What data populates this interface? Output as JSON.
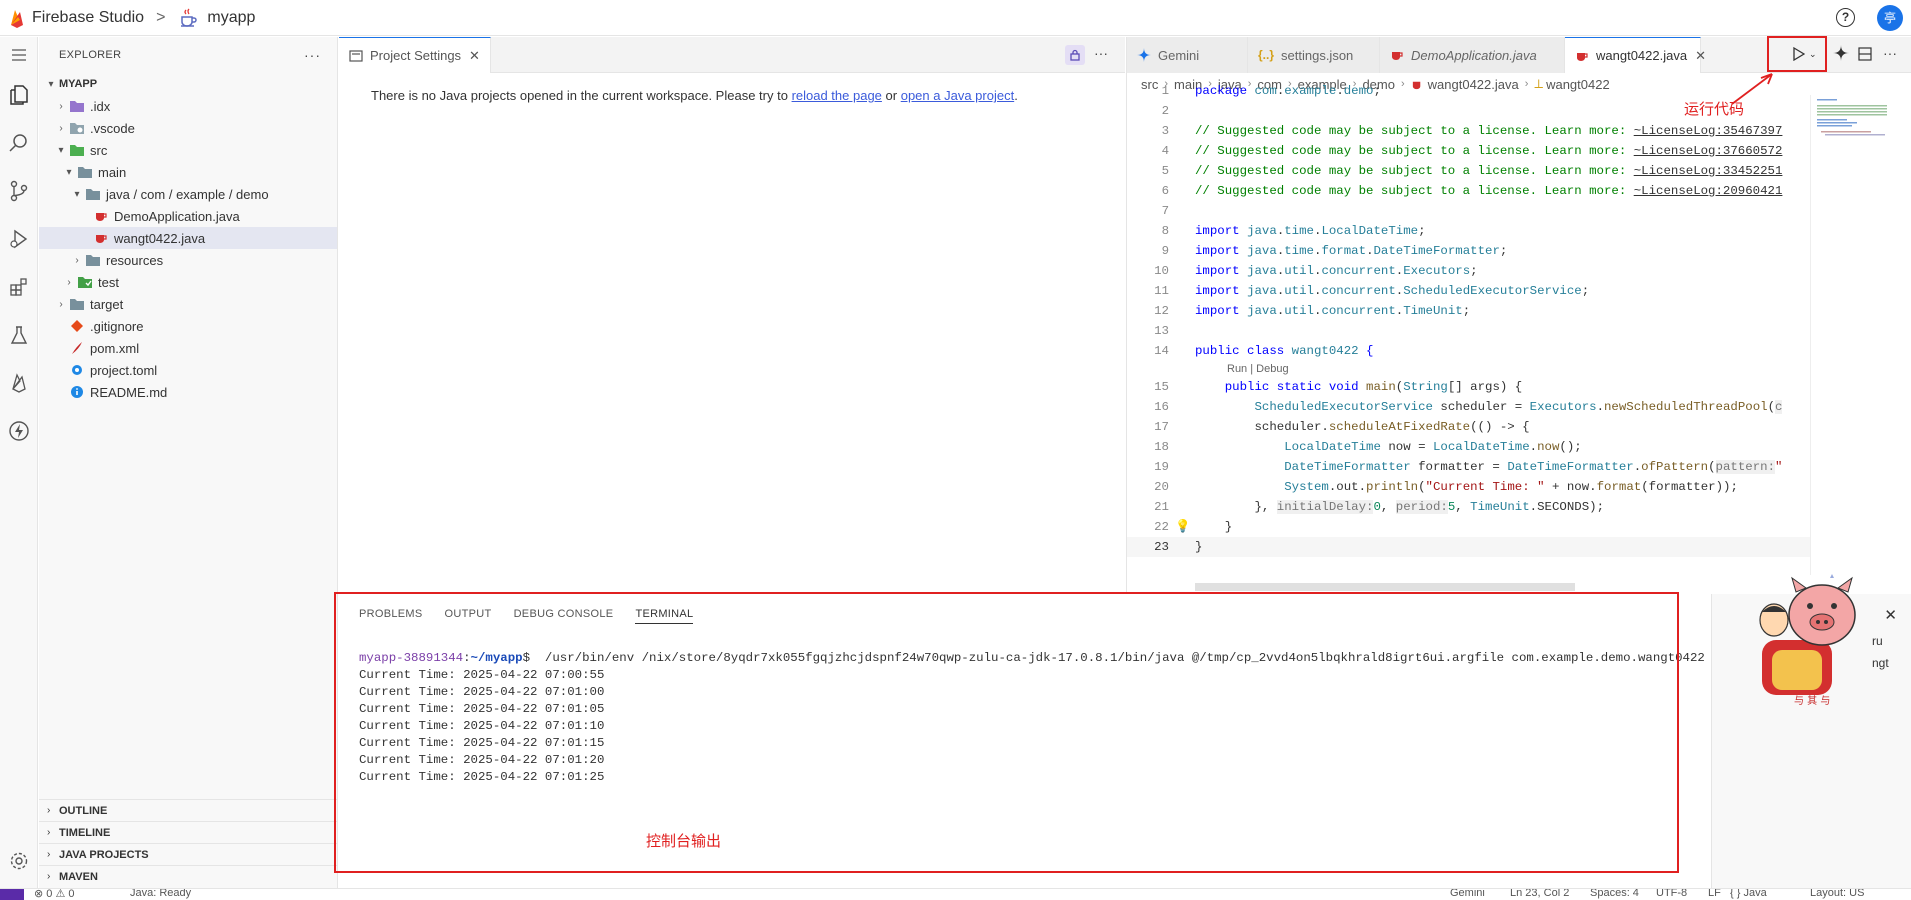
{
  "topbar": {
    "brand": "Firebase Studio",
    "separator": ">",
    "project": "myapp",
    "help": "?",
    "avatar": "亭"
  },
  "explorer": {
    "title": "EXPLORER",
    "more": "···",
    "root": "MYAPP",
    "items": [
      {
        "label": ".idx"
      },
      {
        "label": ".vscode"
      },
      {
        "label": "src"
      },
      {
        "label": "main"
      },
      {
        "label": "java / com / example / demo"
      },
      {
        "label": "DemoApplication.java"
      },
      {
        "label": "wangt0422.java"
      },
      {
        "label": "resources"
      },
      {
        "label": "test"
      },
      {
        "label": "target"
      },
      {
        "label": ".gitignore"
      },
      {
        "label": "pom.xml"
      },
      {
        "label": "project.toml"
      },
      {
        "label": "README.md"
      }
    ],
    "sections": [
      "OUTLINE",
      "TIMELINE",
      "JAVA PROJECTS",
      "MAVEN"
    ]
  },
  "left_editor": {
    "tab": "Project Settings",
    "notice_pre": "There is no Java projects opened in the current workspace. Please try to ",
    "link1": "reload the page",
    "notice_mid": " or ",
    "link2": "open a Java project",
    "notice_post": "."
  },
  "right_editor": {
    "tabs": [
      {
        "label": "Gemini"
      },
      {
        "label": "settings.json"
      },
      {
        "label": "DemoApplication.java"
      },
      {
        "label": "wangt0422.java"
      }
    ],
    "breadcrumb": [
      "src",
      "main",
      "java",
      "com",
      "example",
      "demo",
      "wangt0422.java",
      "wangt0422"
    ],
    "codelens": "Run | Debug",
    "line_numbers": [
      "1",
      "2",
      "3",
      "4",
      "5",
      "6",
      "7",
      "8",
      "9",
      "10",
      "11",
      "12",
      "13",
      "14",
      "15",
      "16",
      "17",
      "18",
      "19",
      "20",
      "21",
      "22",
      "23"
    ]
  },
  "annotations": {
    "run": "运行代码",
    "console": "控制台输出"
  },
  "panel": {
    "tabs": [
      "PROBLEMS",
      "OUTPUT",
      "DEBUG CONSOLE",
      "TERMINAL"
    ],
    "prompt_user": "myapp-38891344",
    "prompt_path": "~/myapp",
    "command": "$  /usr/bin/env /nix/store/8yqdr7xk055fgqjzhcjdspnf24w70qwp-zulu-ca-jdk-17.0.8.1/bin/java @/tmp/cp_2vvd4on5lbqkhrald8igrt6ui.argfile com.example.demo.wangt0422",
    "output": [
      "Current Time: 2025-04-22 07:00:55",
      "Current Time: 2025-04-22 07:01:00",
      "Current Time: 2025-04-22 07:01:05",
      "Current Time: 2025-04-22 07:01:10",
      "Current Time: 2025-04-22 07:01:15",
      "Current Time: 2025-04-22 07:01:20",
      "Current Time: 2025-04-22 07:01:25"
    ],
    "side_text1": "ru",
    "side_text2": "ngt",
    "close": "✕"
  },
  "statusbar": {
    "problems": "⊗ 0 ⚠ 0",
    "java": "Java: Ready",
    "gemini": "Gemini",
    "position": "Ln 23, Col 2",
    "spaces": "Spaces: 4",
    "encoding": "UTF-8",
    "eol": "LF",
    "lang": "{ } Java",
    "layout": "Layout: US"
  },
  "colors": {
    "accent": "#1a73e8",
    "annotation": "#e02020",
    "java_icon": "#d32f2f"
  }
}
